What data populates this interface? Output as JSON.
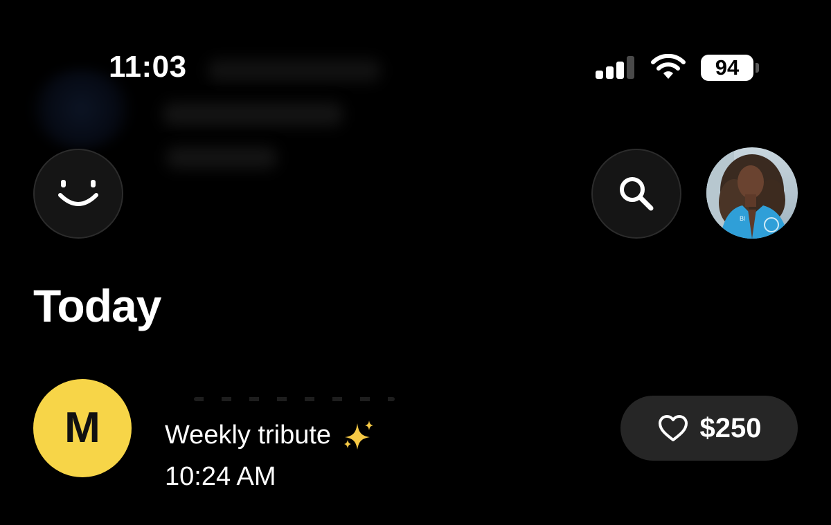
{
  "status_bar": {
    "time": "11:03",
    "battery_level": "94",
    "signal_bars_active": 3,
    "signal_bars_total": 4
  },
  "header": {
    "left_button_icon": "smiley-face-icon",
    "search_button_icon": "search-icon",
    "profile_avatar_icon": "profile-photo"
  },
  "section": {
    "title": "Today"
  },
  "transactions": [
    {
      "avatar_initial": "M",
      "avatar_color": "#f7d548",
      "description": "Weekly tribute",
      "description_emoji": "sparkles-icon",
      "time": "10:24 AM",
      "amount": "$250",
      "amount_icon": "heart-outline-icon"
    }
  ],
  "colors": {
    "background": "#000000",
    "button_bg": "#151515",
    "pill_bg": "#262626",
    "text": "#ffffff",
    "avatar_yellow": "#f7d548"
  }
}
